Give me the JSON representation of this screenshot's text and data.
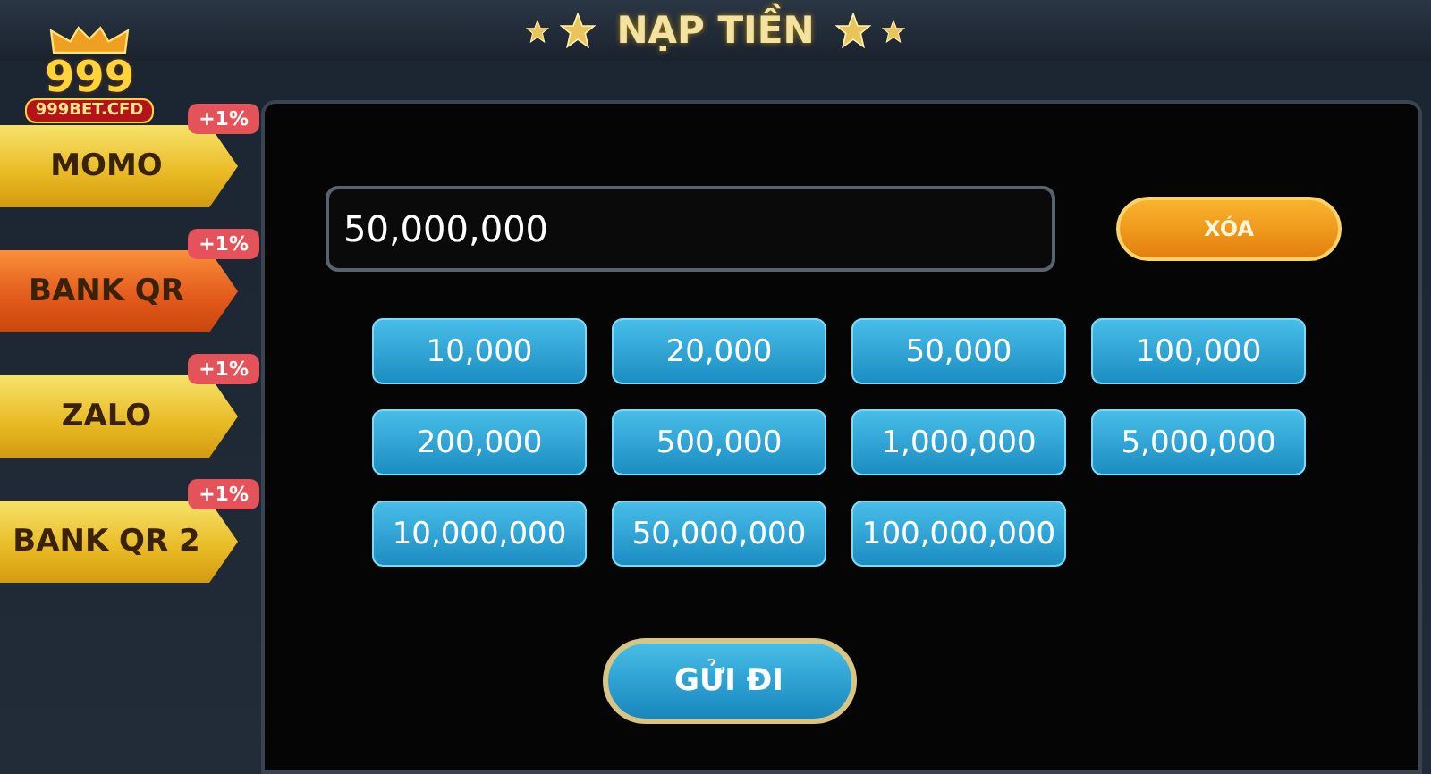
{
  "logo": {
    "numerals": "999",
    "domain": "999BET.CFD"
  },
  "title": "NẠP TIỀN",
  "methods": [
    {
      "label": "MOMO",
      "badge": "+1%",
      "selected": false
    },
    {
      "label": "BANK QR",
      "badge": "+1%",
      "selected": true
    },
    {
      "label": "ZALO",
      "badge": "+1%",
      "selected": false
    },
    {
      "label": "BANK QR 2",
      "badge": "+1%",
      "selected": false
    }
  ],
  "amount_field": {
    "value": "50,000,000"
  },
  "clear_button": "XÓA",
  "amounts": [
    "10,000",
    "20,000",
    "50,000",
    "100,000",
    "200,000",
    "500,000",
    "1,000,000",
    "5,000,000",
    "10,000,000",
    "50,000,000",
    "100,000,000"
  ],
  "submit_button": "GỬI ĐI"
}
